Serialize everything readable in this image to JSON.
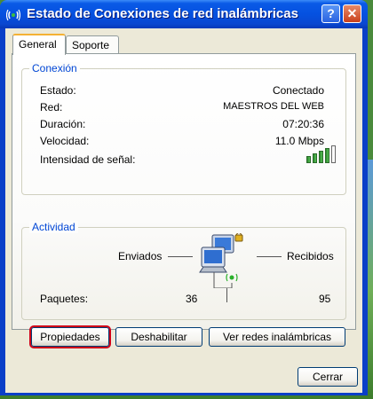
{
  "window": {
    "title": "Estado de Conexiones de red inalámbricas",
    "help_label": "?",
    "close_label": "✕"
  },
  "tabs": [
    {
      "label": "General",
      "active": true
    },
    {
      "label": "Soporte",
      "active": false
    }
  ],
  "connection": {
    "group_label": "Conexión",
    "rows": [
      {
        "label": "Estado:",
        "value": "Conectado"
      },
      {
        "label": "Red:",
        "value": "MAESTROS DEL WEB"
      },
      {
        "label": "Duración:",
        "value": "07:20:36"
      },
      {
        "label": "Velocidad:",
        "value": "11.0 Mbps"
      }
    ],
    "signal_label": "Intensidad de señal:",
    "signal_bars_filled": 4,
    "signal_bars_total": 5
  },
  "activity": {
    "group_label": "Actividad",
    "sent_label": "Enviados",
    "received_label": "Recibidos",
    "packets_label": "Paquetes:",
    "packets_sent": "36",
    "packets_received": "95"
  },
  "buttons": {
    "properties": "Propiedades",
    "disable": "Deshabilitar",
    "view_networks": "Ver redes inalámbricas",
    "close": "Cerrar"
  },
  "colors": {
    "titlebar": "#0551e0",
    "group_label": "#0046d5",
    "focus_ring": "#d00018"
  }
}
